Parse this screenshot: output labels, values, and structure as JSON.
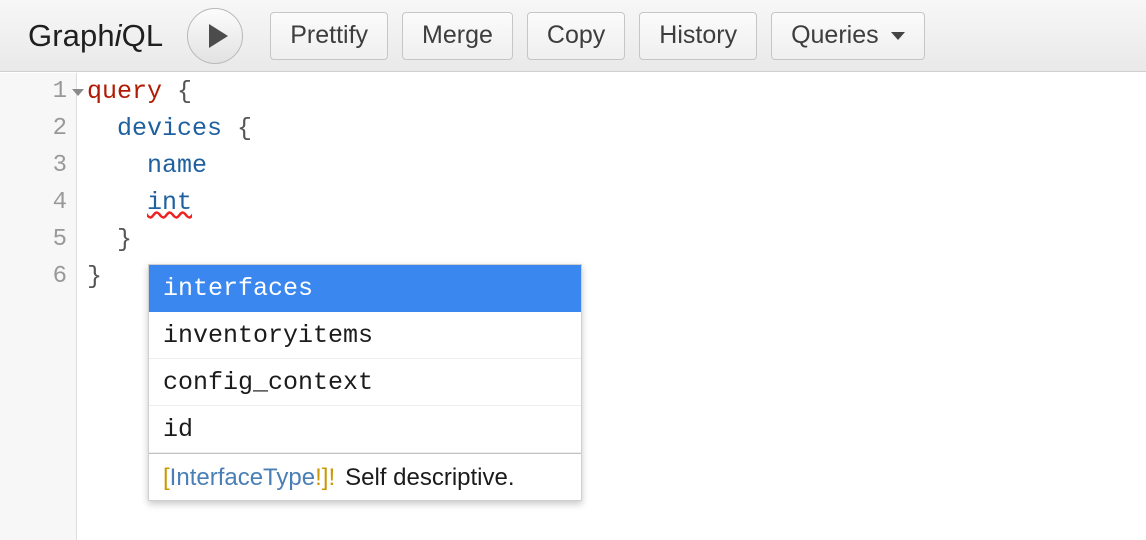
{
  "app": {
    "name_prefix": "Graph",
    "name_emph": "i",
    "name_suffix": "QL"
  },
  "toolbar": {
    "execute_label": "▶",
    "execute_icon": "play-icon",
    "buttons": [
      {
        "label": "Prettify",
        "name": "prettify-button"
      },
      {
        "label": "Merge",
        "name": "merge-button"
      },
      {
        "label": "Copy",
        "name": "copy-button"
      },
      {
        "label": "History",
        "name": "history-button"
      },
      {
        "label": "Queries",
        "name": "queries-button",
        "caret": true
      }
    ]
  },
  "editor": {
    "gutter": [
      {
        "number": "1",
        "fold": true
      },
      {
        "number": "2",
        "fold": false
      },
      {
        "number": "3",
        "fold": false
      },
      {
        "number": "4",
        "fold": false
      },
      {
        "number": "5",
        "fold": false
      },
      {
        "number": "6",
        "fold": false
      }
    ],
    "lines": [
      {
        "keyword": "query",
        "rest": " {"
      },
      {
        "indent": "  ",
        "field": "devices",
        "rest": " {"
      },
      {
        "indent": "    ",
        "field": "name",
        "rest": ""
      },
      {
        "indent": "    ",
        "error_field": "int",
        "rest": ""
      },
      {
        "indent": "  ",
        "rest": "}"
      },
      {
        "indent": "",
        "rest": "}"
      }
    ]
  },
  "autocomplete": {
    "items": [
      {
        "label": "interfaces",
        "selected": true
      },
      {
        "label": "inventoryitems",
        "selected": false
      },
      {
        "label": "config_context",
        "selected": false
      },
      {
        "label": "id",
        "selected": false
      }
    ],
    "info": {
      "open_bracket": "[",
      "type_name": "InterfaceType",
      "inner_bang": "!",
      "close_bracket": "]",
      "outer_bang": "!",
      "description": "Self descriptive."
    }
  },
  "colors": {
    "accent_selection": "#3b87f0",
    "keyword": "#b11a04",
    "field": "#1f61a0",
    "type_punct": "#ca9800",
    "type_name": "#4a7fb5",
    "error_underline": "#ee2222"
  }
}
